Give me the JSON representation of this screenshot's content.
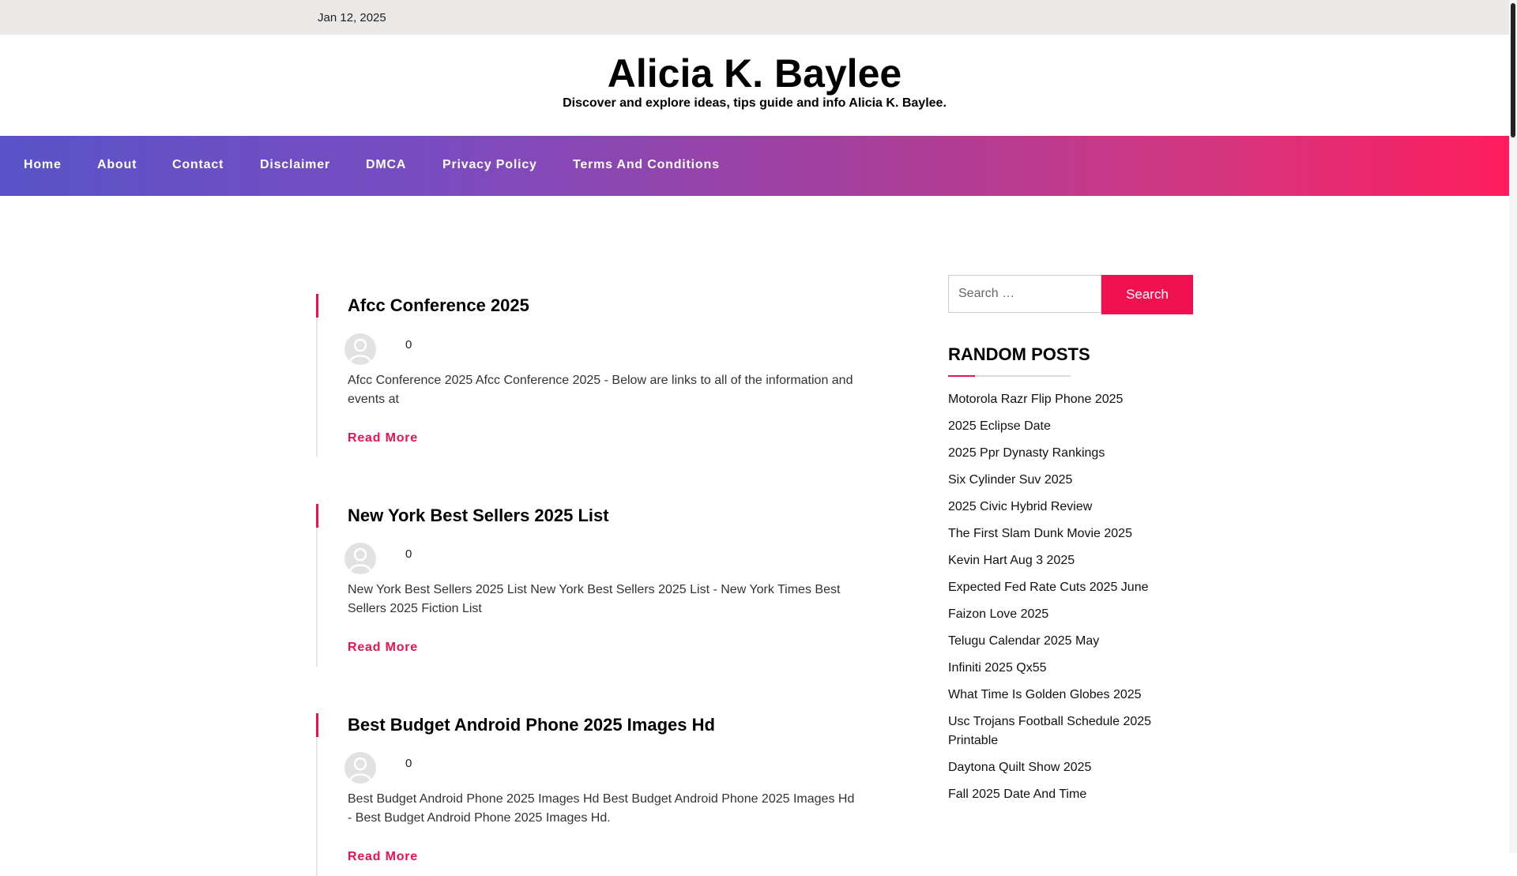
{
  "topbar": {
    "date": "Jan 12, 2025"
  },
  "site": {
    "title": "Alicia K. Baylee",
    "description": "Discover and explore ideas, tips guide and info Alicia K. Baylee."
  },
  "nav": {
    "items": [
      {
        "label": "Home"
      },
      {
        "label": "About"
      },
      {
        "label": "Contact"
      },
      {
        "label": "Disclaimer"
      },
      {
        "label": "DMCA"
      },
      {
        "label": "Privacy Policy"
      },
      {
        "label": "Terms And Conditions"
      }
    ]
  },
  "posts": [
    {
      "title": "Afcc Conference 2025",
      "comments": "0",
      "excerpt": "Afcc Conference 2025 Afcc Conference 2025 - Below are links to all of the information and events at",
      "read_more": "Read More"
    },
    {
      "title": "New York Best Sellers 2025 List",
      "comments": "0",
      "excerpt": "New York Best Sellers 2025 List New York Best Sellers 2025 List - New York Times Best Sellers 2025 Fiction List",
      "read_more": "Read More"
    },
    {
      "title": "Best Budget Android Phone 2025 Images Hd",
      "comments": "0",
      "excerpt": "Best Budget Android Phone 2025 Images Hd Best Budget Android Phone 2025 Images Hd - Best Budget Android Phone 2025 Images Hd.",
      "read_more": "Read More"
    }
  ],
  "sidebar": {
    "search": {
      "placeholder": "Search …",
      "button": "Search"
    },
    "random_posts_title": "RANDOM POSTS",
    "random_posts": [
      "Motorola Razr Flip Phone 2025",
      "2025 Eclipse Date",
      "2025 Ppr Dynasty Rankings",
      "Six Cylinder Suv 2025",
      "2025 Civic Hybrid Review",
      "The First Slam Dunk Movie 2025",
      "Kevin Hart Aug 3 2025",
      "Expected Fed Rate Cuts 2025 June",
      "Faizon Love 2025",
      "Telugu Calendar 2025 May",
      "Infiniti 2025 Qx55",
      "What Time Is Golden Globes 2025",
      "Usc Trojans Football Schedule 2025 Printable",
      "Daytona Quilt Show 2025",
      "Fall 2025 Date And Time"
    ]
  },
  "colors": {
    "accent": "#f01250",
    "nav_gradient_start": "#5a53c9",
    "nav_gradient_end": "#ff1d5e",
    "topbar": "#ebe8e8"
  }
}
